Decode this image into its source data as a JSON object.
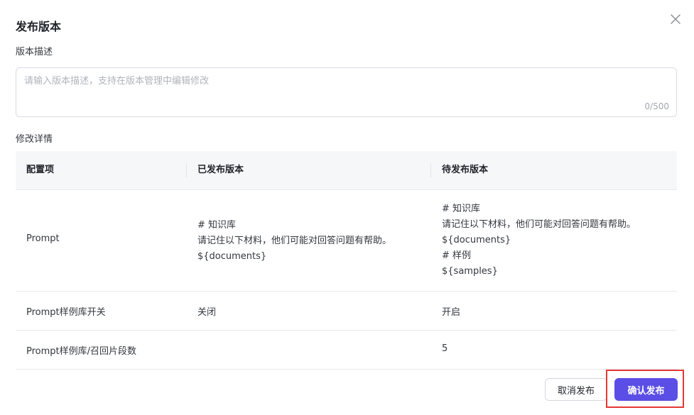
{
  "dialog": {
    "title": "发布版本",
    "close_icon": "close-icon"
  },
  "description": {
    "label": "版本描述",
    "placeholder": "请输入版本描述，支持在版本管理中编辑修改",
    "value": "",
    "counter": "0/500"
  },
  "details": {
    "label": "修改详情",
    "columns": [
      "配置项",
      "已发布版本",
      "待发布版本"
    ],
    "rows": [
      {
        "item": "Prompt",
        "published": "# 知识库\n请记住以下材料，他们可能对回答问题有帮助。\n${documents}",
        "pending": "# 知识库\n请记住以下材料，他们可能对回答问题有帮助。\n${documents}\n# 样例\n${samples}"
      },
      {
        "item": "Prompt样例库开关",
        "published": "关闭",
        "pending": "开启"
      },
      {
        "item": "Prompt样例库/召回片段数",
        "published": "",
        "pending": "5"
      }
    ]
  },
  "footer": {
    "cancel_label": "取消发布",
    "confirm_label": "确认发布"
  },
  "colors": {
    "primary": "#5b4ee6",
    "highlight": "#e53935"
  }
}
